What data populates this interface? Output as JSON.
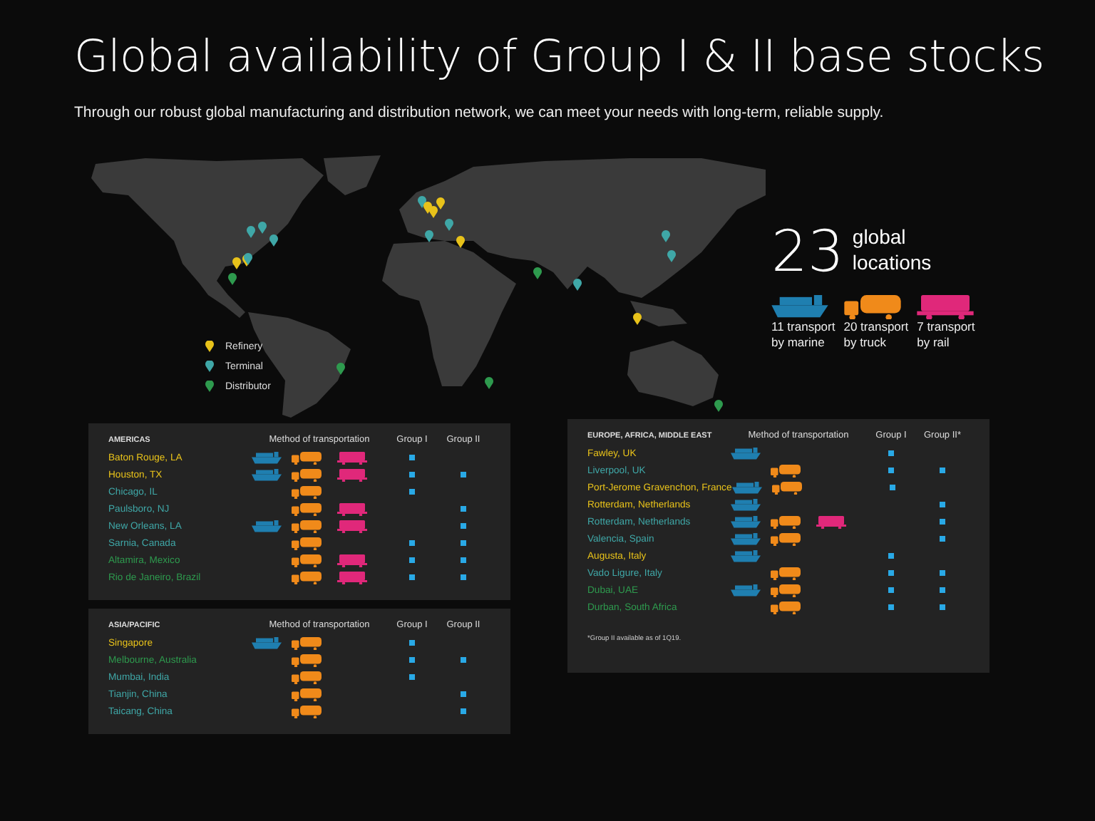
{
  "title": "Global availability of Group I & II base stocks",
  "subtitle": "Through our robust global manufacturing and distribution network, we can meet your needs with long-term, reliable supply.",
  "map": {
    "legend": [
      {
        "label": "Refinery",
        "color": "#e8c21a"
      },
      {
        "label": "Terminal",
        "color": "#3fa7a7"
      },
      {
        "label": "Distributor",
        "color": "#2e9a4e"
      }
    ]
  },
  "stats": {
    "count": "23",
    "label_line_1": "global",
    "label_line_2": "locations",
    "modes": [
      {
        "kind": "marine",
        "line_1": "11 transport",
        "line_2": "by marine"
      },
      {
        "kind": "truck",
        "line_1": "20 transport",
        "line_2": "by truck"
      },
      {
        "kind": "rail",
        "line_1": "7 transport",
        "line_2": "by rail"
      }
    ]
  },
  "regions": [
    {
      "name": "AMERICAS",
      "column_method": "Method of transportation",
      "column_group_1": "Group I",
      "column_group_2": "Group II",
      "rows": [
        {
          "name": "Baton Rouge, LA",
          "color": "#e8c21a",
          "marine": true,
          "truck": true,
          "rail": true,
          "group_1": true,
          "group_2": false
        },
        {
          "name": "Houston, TX",
          "color": "#e8c21a",
          "marine": true,
          "truck": true,
          "rail": true,
          "group_1": true,
          "group_2": true
        },
        {
          "name": "Chicago, IL",
          "color": "#3fa7a7",
          "marine": false,
          "truck": true,
          "rail": false,
          "group_1": true,
          "group_2": false
        },
        {
          "name": "Paulsboro, NJ",
          "color": "#3fa7a7",
          "marine": false,
          "truck": true,
          "rail": true,
          "group_1": false,
          "group_2": true
        },
        {
          "name": "New Orleans, LA",
          "color": "#3fa7a7",
          "marine": true,
          "truck": true,
          "rail": true,
          "group_1": false,
          "group_2": true
        },
        {
          "name": "Sarnia, Canada",
          "color": "#3fa7a7",
          "marine": false,
          "truck": true,
          "rail": false,
          "group_1": true,
          "group_2": true
        },
        {
          "name": "Altamira, Mexico",
          "color": "#2e9a4e",
          "marine": false,
          "truck": true,
          "rail": true,
          "group_1": true,
          "group_2": true
        },
        {
          "name": "Rio de Janeiro, Brazil",
          "color": "#2e9a4e",
          "marine": false,
          "truck": true,
          "rail": true,
          "group_1": true,
          "group_2": true
        }
      ]
    },
    {
      "name": "ASIA/PACIFIC",
      "column_method": "Method of transportation",
      "column_group_1": "Group I",
      "column_group_2": "Group II",
      "rows": [
        {
          "name": "Singapore",
          "color": "#e8c21a",
          "marine": true,
          "truck": true,
          "rail": false,
          "group_1": true,
          "group_2": false
        },
        {
          "name": "Melbourne, Australia",
          "color": "#2e9a4e",
          "marine": false,
          "truck": true,
          "rail": false,
          "group_1": true,
          "group_2": true
        },
        {
          "name": "Mumbai, India",
          "color": "#3fa7a7",
          "marine": false,
          "truck": true,
          "rail": false,
          "group_1": true,
          "group_2": false
        },
        {
          "name": "Tianjin, China",
          "color": "#3fa7a7",
          "marine": false,
          "truck": true,
          "rail": false,
          "group_1": false,
          "group_2": true
        },
        {
          "name": "Taicang, China",
          "color": "#3fa7a7",
          "marine": false,
          "truck": true,
          "rail": false,
          "group_1": false,
          "group_2": true
        }
      ]
    },
    {
      "name": "EUROPE, AFRICA, MIDDLE EAST",
      "column_method": "Method of transportation",
      "column_group_1": "Group I",
      "column_group_2": "Group II*",
      "footnote": "*Group II available as of 1Q19.",
      "rows": [
        {
          "name": "Fawley, UK",
          "color": "#e8c21a",
          "marine": true,
          "truck": false,
          "rail": false,
          "group_1": true,
          "group_2": false
        },
        {
          "name": "Liverpool, UK",
          "color": "#3fa7a7",
          "marine": false,
          "truck": true,
          "rail": false,
          "group_1": true,
          "group_2": true
        },
        {
          "name": "Port-Jerome Gravenchon, France",
          "color": "#e8c21a",
          "marine": true,
          "truck": true,
          "rail": false,
          "group_1": true,
          "group_2": false
        },
        {
          "name": "Rotterdam, Netherlands",
          "color": "#e8c21a",
          "marine": true,
          "truck": false,
          "rail": false,
          "group_1": false,
          "group_2": true
        },
        {
          "name": "Rotterdam, Netherlands",
          "color": "#3fa7a7",
          "marine": true,
          "truck": true,
          "rail": true,
          "group_1": false,
          "group_2": true
        },
        {
          "name": "Valencia, Spain",
          "color": "#3fa7a7",
          "marine": true,
          "truck": true,
          "rail": false,
          "group_1": false,
          "group_2": true
        },
        {
          "name": "Augusta, Italy",
          "color": "#e8c21a",
          "marine": true,
          "truck": false,
          "rail": false,
          "group_1": true,
          "group_2": false
        },
        {
          "name": "Vado Ligure, Italy",
          "color": "#3fa7a7",
          "marine": false,
          "truck": true,
          "rail": false,
          "group_1": true,
          "group_2": true
        },
        {
          "name": "Dubai, UAE",
          "color": "#2e9a4e",
          "marine": true,
          "truck": true,
          "rail": false,
          "group_1": true,
          "group_2": true
        },
        {
          "name": "Durban, South Africa",
          "color": "#2e9a4e",
          "marine": false,
          "truck": true,
          "rail": false,
          "group_1": true,
          "group_2": true
        }
      ]
    }
  ]
}
